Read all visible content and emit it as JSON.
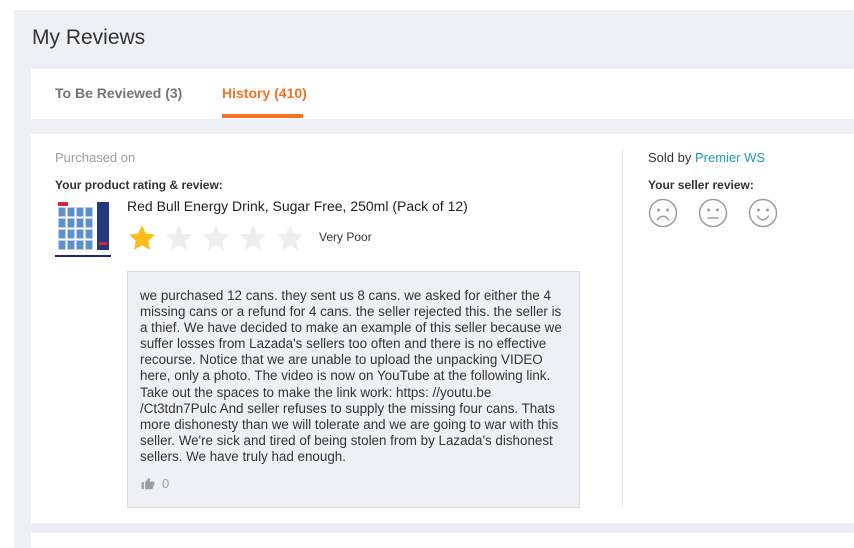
{
  "page": {
    "title": "My Reviews"
  },
  "tabs": [
    {
      "label": "To Be Reviewed (3)",
      "active": false
    },
    {
      "label": "History (410)",
      "active": true
    }
  ],
  "review": {
    "purchased_on_label": "Purchased on",
    "rating_heading": "Your product rating & review:",
    "product_name": "Red Bull Energy Drink, Sugar Free, 250ml (Pack of 12)",
    "rating": 1,
    "max_rating": 5,
    "rating_text": "Very Poor",
    "text": "we purchased 12 cans. they sent us 8 cans. we asked for either the 4 missing cans or a refund for 4 cans. the seller rejected this. the seller is a thief. We have decided to make an example of this seller because we suffer losses from Lazada's sellers too often and there is no effective recourse. Notice that we are unable to upload the unpacking VIDEO here, only a photo. The video is now on YouTube at the following link. Take out the spaces to make the link work: https: //youtu.be    /Ct3tdn7Pulc   And seller refuses to supply the missing four cans. Thats more dishonesty than we will tolerate and we are going to war with this seller. We're sick and tired of being stolen from by Lazada's dishonest sellers. We have truly had enough.",
    "likes": "0"
  },
  "seller": {
    "sold_by_label": "Sold by",
    "name": "Premier WS",
    "review_heading": "Your seller review:",
    "faces": [
      "sad-face-icon",
      "neutral-face-icon",
      "happy-face-icon"
    ]
  },
  "colors": {
    "accent": "#f57224",
    "link": "#1a9cb7",
    "star_filled": "#fcbc1a",
    "star_empty": "#eeeeee",
    "background": "#eff0f5"
  }
}
